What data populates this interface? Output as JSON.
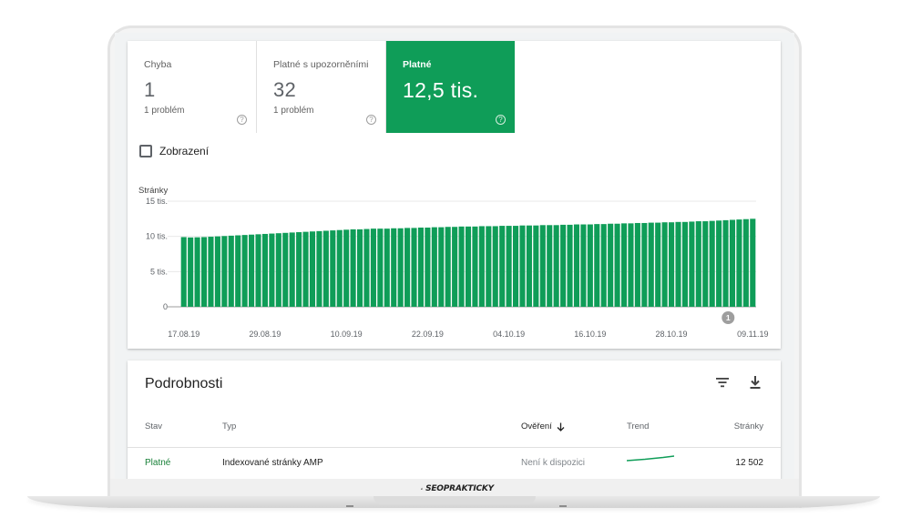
{
  "summary": {
    "metrics": [
      {
        "label": "Chyba",
        "value": "1",
        "sub": "1 problém",
        "active": false
      },
      {
        "label": "Platné s upozorněními",
        "value": "32",
        "sub": "1 problém",
        "active": false
      },
      {
        "label": "Platné",
        "value": "12,5 tis.",
        "sub": "",
        "active": true
      }
    ],
    "impressions_checkbox": {
      "label": "Zobrazení",
      "checked": false
    }
  },
  "chart_data": {
    "type": "bar",
    "ylabel": "Stránky",
    "ylim": [
      0,
      15000
    ],
    "y_ticks": [
      "0",
      "5 tis.",
      "10 tis.",
      "15 tis."
    ],
    "y_tick_values": [
      0,
      5000,
      10000,
      15000
    ],
    "x_tick_labels": [
      "17.08.19",
      "29.08.19",
      "10.09.19",
      "22.09.19",
      "04.10.19",
      "16.10.19",
      "28.10.19",
      "09.11.19"
    ],
    "start_value": 9900,
    "values": [
      9900,
      9850,
      9870,
      9900,
      9950,
      10000,
      10050,
      10100,
      10150,
      10200,
      10250,
      10300,
      10350,
      10400,
      10450,
      10500,
      10550,
      10600,
      10650,
      10700,
      10750,
      10800,
      10850,
      10900,
      10950,
      11000,
      11000,
      11050,
      11100,
      11100,
      11100,
      11150,
      11150,
      11200,
      11200,
      11250,
      11250,
      11300,
      11300,
      11350,
      11350,
      11400,
      11400,
      11400,
      11450,
      11450,
      11450,
      11500,
      11500,
      11500,
      11550,
      11550,
      11550,
      11600,
      11600,
      11600,
      11650,
      11650,
      11700,
      11700,
      11700,
      11750,
      11750,
      11800,
      11800,
      11850,
      11850,
      11900,
      11900,
      11950,
      11950,
      12000,
      12000,
      12050,
      12050,
      12100,
      12150,
      12150,
      12200,
      12250,
      12300,
      12350,
      12400,
      12450,
      12500
    ],
    "annotation": {
      "label": "1",
      "near_tick": "09.11.19"
    },
    "bar_color": "#0f9d58"
  },
  "details": {
    "title": "Podrobnosti",
    "filter_icon": "filter-icon",
    "download_icon": "download-icon",
    "columns": [
      "Stav",
      "Typ",
      "Ověření",
      "Trend",
      "Stránky"
    ],
    "sorted_column": "Ověření",
    "rows": [
      {
        "status": "Platné",
        "type": "Indexované stránky AMP",
        "validation": "Není k dispozici",
        "pages": "12 502"
      }
    ]
  },
  "brand": {
    "text": "SEOPRAKTICKY"
  }
}
